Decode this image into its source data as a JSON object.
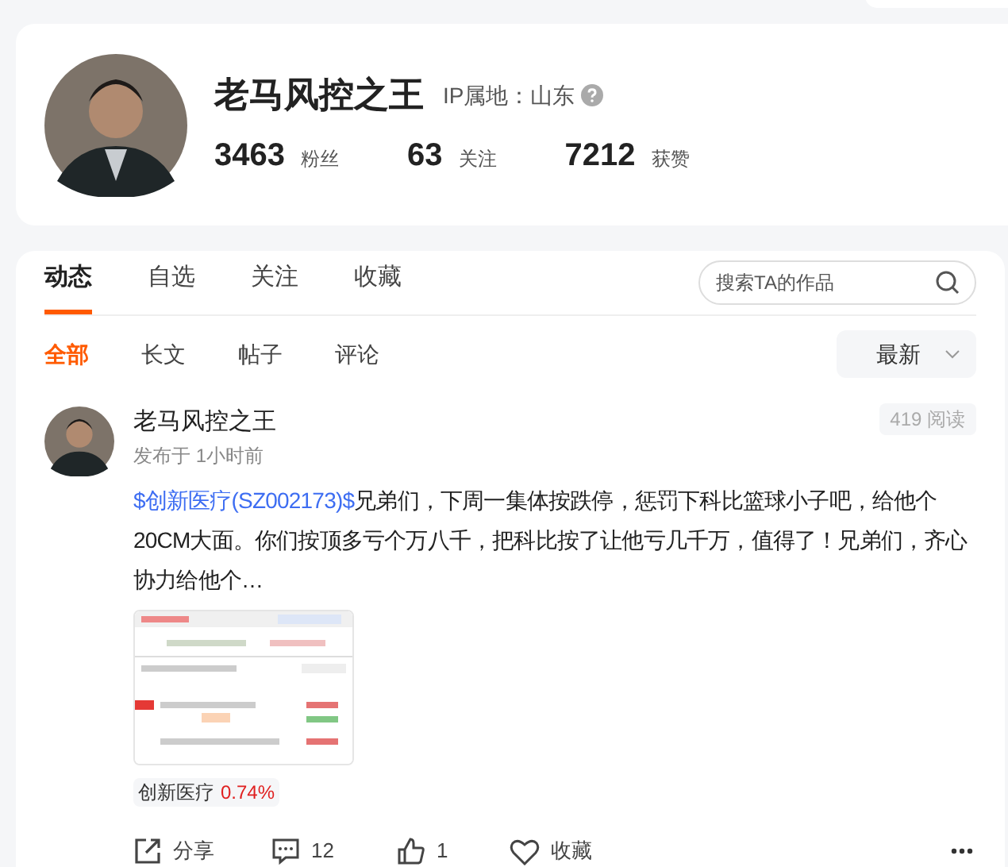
{
  "profile": {
    "name": "老马风控之王",
    "ip_location": "IP属地：山东",
    "stats": [
      {
        "value": "3463",
        "label": "粉丝"
      },
      {
        "value": "63",
        "label": "关注"
      },
      {
        "value": "7212",
        "label": "获赞"
      }
    ]
  },
  "tabs": [
    {
      "label": "动态",
      "selected": true
    },
    {
      "label": "自选",
      "selected": false
    },
    {
      "label": "关注",
      "selected": false
    },
    {
      "label": "收藏",
      "selected": false
    }
  ],
  "search": {
    "placeholder": "搜索TA的作品"
  },
  "filters": [
    {
      "label": "全部",
      "selected": true
    },
    {
      "label": "长文",
      "selected": false
    },
    {
      "label": "帖子",
      "selected": false
    },
    {
      "label": "评论",
      "selected": false
    }
  ],
  "sort": {
    "value": "最新"
  },
  "posts": [
    {
      "author": "老马风控之王",
      "time": "发布于 1小时前",
      "reads": "419 阅读",
      "link": "$创新医疗(SZ002173)$",
      "text": "兄弟们，下周一集体按跌停，惩罚下科比篮球小子吧，给他个20CM大面。你们按顶多亏个万八千，把科比按了让他亏几千万，值得了！兄弟们，齐心协力给他个…",
      "tag": {
        "name": "创新医疗",
        "change": "0.74%"
      },
      "actions": [
        {
          "kind": "share",
          "label": "分享"
        },
        {
          "kind": "comment",
          "label": "12"
        },
        {
          "kind": "like",
          "label": "1"
        },
        {
          "kind": "favorite",
          "label": "收藏"
        }
      ]
    }
  ]
}
